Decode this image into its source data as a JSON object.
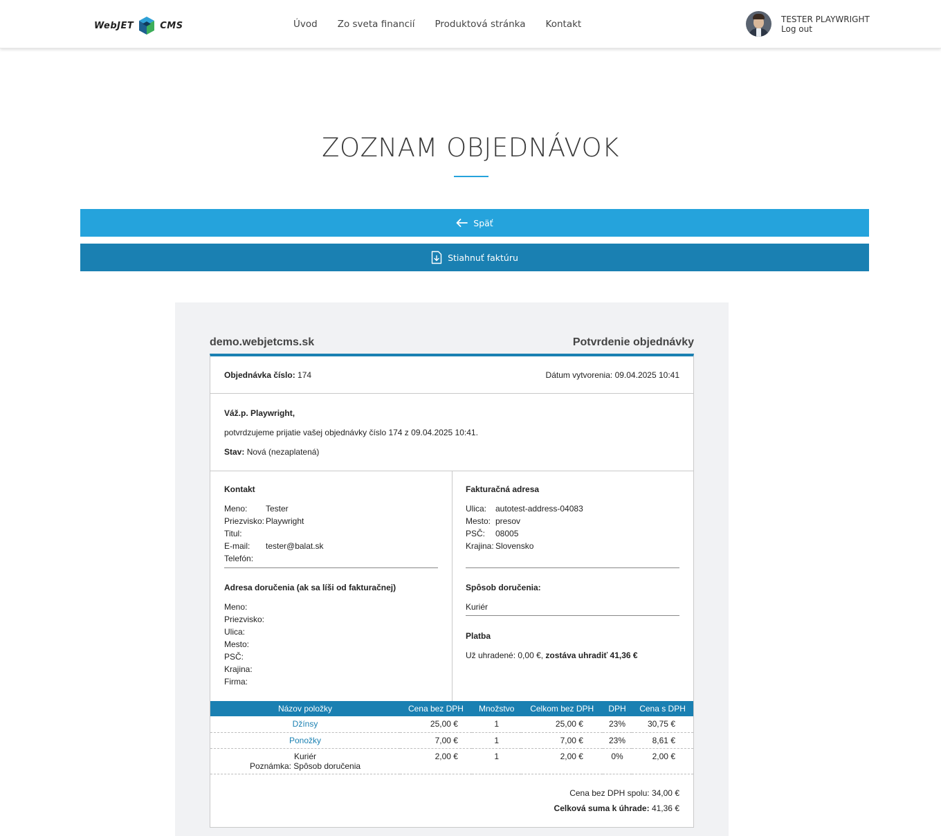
{
  "header": {
    "logo_left": "WebJET",
    "logo_right": "CMS",
    "nav": [
      "Úvod",
      "Zo sveta financií",
      "Produktová stránka",
      "Kontakt"
    ],
    "user_name": "TESTER PLAYWRIGHT",
    "logout": "Log out"
  },
  "page": {
    "title": "ZOZNAM OBJEDNÁVOK",
    "back_label": "Späť",
    "invoice_label": "Stiahnuť faktúru"
  },
  "invoice": {
    "site": "demo.webjetcms.sk",
    "doc_title": "Potvrdenie objednávky",
    "order_label": "Objednávka číslo:",
    "order_number": "174",
    "date_label": "Dátum vytvorenia:",
    "date_value": "09.04.2025 10:41",
    "greeting": "Váž.p. Playwright,",
    "confirm_text": "potvrdzujeme prijatie vašej objednávky číslo 174 z 09.04.2025 10:41.",
    "status_label": "Stav:",
    "status_value": "Nová (nezaplatená)",
    "contact": {
      "title": "Kontakt",
      "rows": [
        {
          "k": "Meno:",
          "v": "Tester"
        },
        {
          "k": "Priezvisko:",
          "v": "Playwright"
        },
        {
          "k": "Titul:",
          "v": ""
        },
        {
          "k": "E-mail:",
          "v": "tester@balat.sk"
        },
        {
          "k": "Telefón:",
          "v": ""
        }
      ]
    },
    "billing": {
      "title": "Fakturačná adresa",
      "rows": [
        {
          "k": "Ulica:",
          "v": "autotest-address-04083"
        },
        {
          "k": "Mesto:",
          "v": "presov"
        },
        {
          "k": "PSČ:",
          "v": "08005"
        },
        {
          "k": "Krajina:",
          "v": "Slovensko"
        }
      ]
    },
    "delivery_address": {
      "title": "Adresa doručenia (ak sa líši od fakturačnej)",
      "rows": [
        "Meno:",
        "Priezvisko:",
        "Ulica:",
        "Mesto:",
        "PSČ:",
        "Krajina:",
        "Firma:"
      ]
    },
    "delivery_method": {
      "title": "Spôsob doručenia:",
      "value": "Kuriér"
    },
    "payment": {
      "title": "Platba",
      "paid_text": "Už uhradené: 0,00 €,",
      "remaining_text": "zostáva uhradiť 41,36 €"
    },
    "table": {
      "headers": [
        "Názov položky",
        "Cena bez DPH",
        "Množstvo",
        "Celkom bez DPH",
        "DPH",
        "Cena s DPH"
      ],
      "rows": [
        {
          "name": "Džínsy",
          "note": "",
          "price": "25,00 €",
          "qty": "1",
          "total": "25,00 €",
          "vat": "23%",
          "price_vat": "30,75 €"
        },
        {
          "name": "Ponožky",
          "note": "",
          "price": "7,00 €",
          "qty": "1",
          "total": "7,00 €",
          "vat": "23%",
          "price_vat": "8,61 €"
        },
        {
          "name": "Kuriér",
          "note": "Poznámka: Spôsob doručenia",
          "price": "2,00 €",
          "qty": "1",
          "total": "2,00 €",
          "vat": "0%",
          "price_vat": "2,00 €"
        }
      ]
    },
    "totals": {
      "net_label": "Cena bez DPH spolu:",
      "net_value": "34,00 €",
      "grand_label": "Celková suma k úhrade:",
      "grand_value": "41,36 €"
    }
  }
}
